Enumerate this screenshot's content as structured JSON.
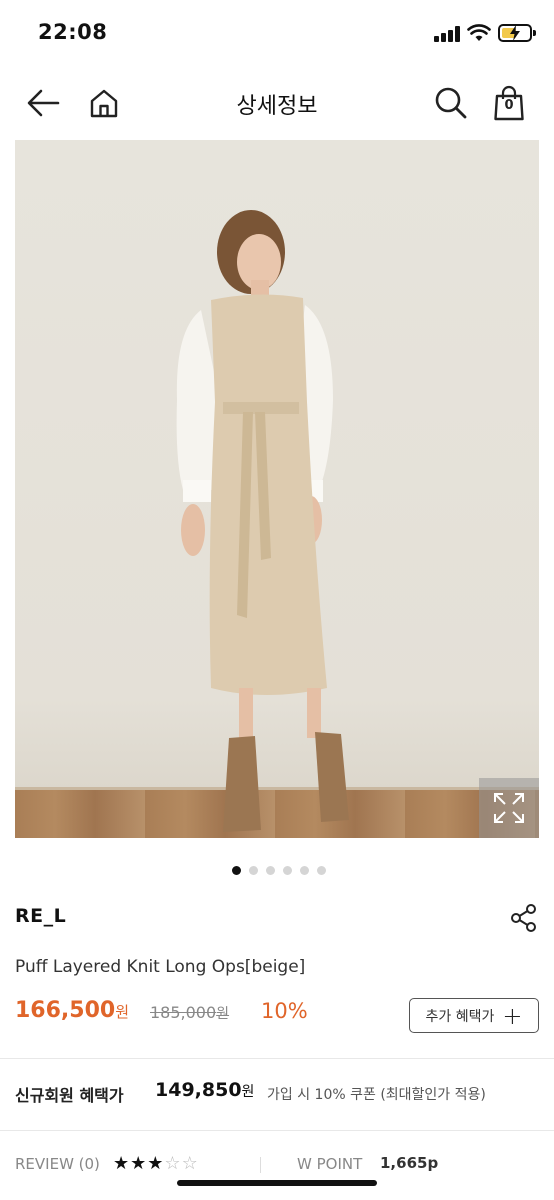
{
  "status_bar": {
    "time": "22:08",
    "icons": [
      "signal-icon",
      "wifi-icon",
      "battery-charging-icon"
    ]
  },
  "nav": {
    "title": "상세정보",
    "cart_count": "0",
    "icons": [
      "back-arrow-icon",
      "home-icon",
      "search-icon",
      "shopping-bag-icon"
    ]
  },
  "gallery": {
    "total_images": 6,
    "active_index": 0,
    "expand_icon": "expand-icon"
  },
  "product": {
    "brand": "RE_L",
    "name": "Puff Layered Knit Long Ops[beige]",
    "sale_price": "166,500",
    "sale_unit": "원",
    "original_price": "185,000",
    "original_unit": "원",
    "discount": "10%",
    "benefit_button": "추가 혜택가",
    "share_icon": "share-icon"
  },
  "member": {
    "label": "신규회원 혜택가",
    "price": "149,850",
    "unit": "원",
    "note": "가입 시 10% 쿠폰 (최대할인가 적용)"
  },
  "review": {
    "label": "REVIEW (0)",
    "stars_filled": 3,
    "stars_total": 5,
    "wpoint_label": "W POINT",
    "wpoint_value": "1,665p"
  },
  "colors": {
    "accent": "#e0652a",
    "text": "#222222",
    "muted": "#888888"
  }
}
